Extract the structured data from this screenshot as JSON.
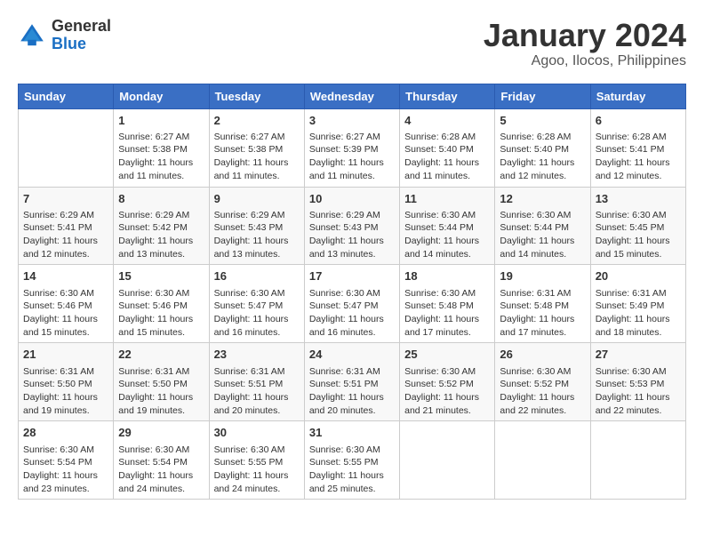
{
  "logo": {
    "general": "General",
    "blue": "Blue"
  },
  "title": "January 2024",
  "subtitle": "Agoo, Ilocos, Philippines",
  "headers": [
    "Sunday",
    "Monday",
    "Tuesday",
    "Wednesday",
    "Thursday",
    "Friday",
    "Saturday"
  ],
  "weeks": [
    [
      {
        "day": "",
        "info": ""
      },
      {
        "day": "1",
        "info": "Sunrise: 6:27 AM\nSunset: 5:38 PM\nDaylight: 11 hours and 11 minutes."
      },
      {
        "day": "2",
        "info": "Sunrise: 6:27 AM\nSunset: 5:38 PM\nDaylight: 11 hours and 11 minutes."
      },
      {
        "day": "3",
        "info": "Sunrise: 6:27 AM\nSunset: 5:39 PM\nDaylight: 11 hours and 11 minutes."
      },
      {
        "day": "4",
        "info": "Sunrise: 6:28 AM\nSunset: 5:40 PM\nDaylight: 11 hours and 11 minutes."
      },
      {
        "day": "5",
        "info": "Sunrise: 6:28 AM\nSunset: 5:40 PM\nDaylight: 11 hours and 12 minutes."
      },
      {
        "day": "6",
        "info": "Sunrise: 6:28 AM\nSunset: 5:41 PM\nDaylight: 11 hours and 12 minutes."
      }
    ],
    [
      {
        "day": "7",
        "info": "Sunrise: 6:29 AM\nSunset: 5:41 PM\nDaylight: 11 hours and 12 minutes."
      },
      {
        "day": "8",
        "info": "Sunrise: 6:29 AM\nSunset: 5:42 PM\nDaylight: 11 hours and 13 minutes."
      },
      {
        "day": "9",
        "info": "Sunrise: 6:29 AM\nSunset: 5:43 PM\nDaylight: 11 hours and 13 minutes."
      },
      {
        "day": "10",
        "info": "Sunrise: 6:29 AM\nSunset: 5:43 PM\nDaylight: 11 hours and 13 minutes."
      },
      {
        "day": "11",
        "info": "Sunrise: 6:30 AM\nSunset: 5:44 PM\nDaylight: 11 hours and 14 minutes."
      },
      {
        "day": "12",
        "info": "Sunrise: 6:30 AM\nSunset: 5:44 PM\nDaylight: 11 hours and 14 minutes."
      },
      {
        "day": "13",
        "info": "Sunrise: 6:30 AM\nSunset: 5:45 PM\nDaylight: 11 hours and 15 minutes."
      }
    ],
    [
      {
        "day": "14",
        "info": "Sunrise: 6:30 AM\nSunset: 5:46 PM\nDaylight: 11 hours and 15 minutes."
      },
      {
        "day": "15",
        "info": "Sunrise: 6:30 AM\nSunset: 5:46 PM\nDaylight: 11 hours and 15 minutes."
      },
      {
        "day": "16",
        "info": "Sunrise: 6:30 AM\nSunset: 5:47 PM\nDaylight: 11 hours and 16 minutes."
      },
      {
        "day": "17",
        "info": "Sunrise: 6:30 AM\nSunset: 5:47 PM\nDaylight: 11 hours and 16 minutes."
      },
      {
        "day": "18",
        "info": "Sunrise: 6:30 AM\nSunset: 5:48 PM\nDaylight: 11 hours and 17 minutes."
      },
      {
        "day": "19",
        "info": "Sunrise: 6:31 AM\nSunset: 5:48 PM\nDaylight: 11 hours and 17 minutes."
      },
      {
        "day": "20",
        "info": "Sunrise: 6:31 AM\nSunset: 5:49 PM\nDaylight: 11 hours and 18 minutes."
      }
    ],
    [
      {
        "day": "21",
        "info": "Sunrise: 6:31 AM\nSunset: 5:50 PM\nDaylight: 11 hours and 19 minutes."
      },
      {
        "day": "22",
        "info": "Sunrise: 6:31 AM\nSunset: 5:50 PM\nDaylight: 11 hours and 19 minutes."
      },
      {
        "day": "23",
        "info": "Sunrise: 6:31 AM\nSunset: 5:51 PM\nDaylight: 11 hours and 20 minutes."
      },
      {
        "day": "24",
        "info": "Sunrise: 6:31 AM\nSunset: 5:51 PM\nDaylight: 11 hours and 20 minutes."
      },
      {
        "day": "25",
        "info": "Sunrise: 6:30 AM\nSunset: 5:52 PM\nDaylight: 11 hours and 21 minutes."
      },
      {
        "day": "26",
        "info": "Sunrise: 6:30 AM\nSunset: 5:52 PM\nDaylight: 11 hours and 22 minutes."
      },
      {
        "day": "27",
        "info": "Sunrise: 6:30 AM\nSunset: 5:53 PM\nDaylight: 11 hours and 22 minutes."
      }
    ],
    [
      {
        "day": "28",
        "info": "Sunrise: 6:30 AM\nSunset: 5:54 PM\nDaylight: 11 hours and 23 minutes."
      },
      {
        "day": "29",
        "info": "Sunrise: 6:30 AM\nSunset: 5:54 PM\nDaylight: 11 hours and 24 minutes."
      },
      {
        "day": "30",
        "info": "Sunrise: 6:30 AM\nSunset: 5:55 PM\nDaylight: 11 hours and 24 minutes."
      },
      {
        "day": "31",
        "info": "Sunrise: 6:30 AM\nSunset: 5:55 PM\nDaylight: 11 hours and 25 minutes."
      },
      {
        "day": "",
        "info": ""
      },
      {
        "day": "",
        "info": ""
      },
      {
        "day": "",
        "info": ""
      }
    ]
  ]
}
